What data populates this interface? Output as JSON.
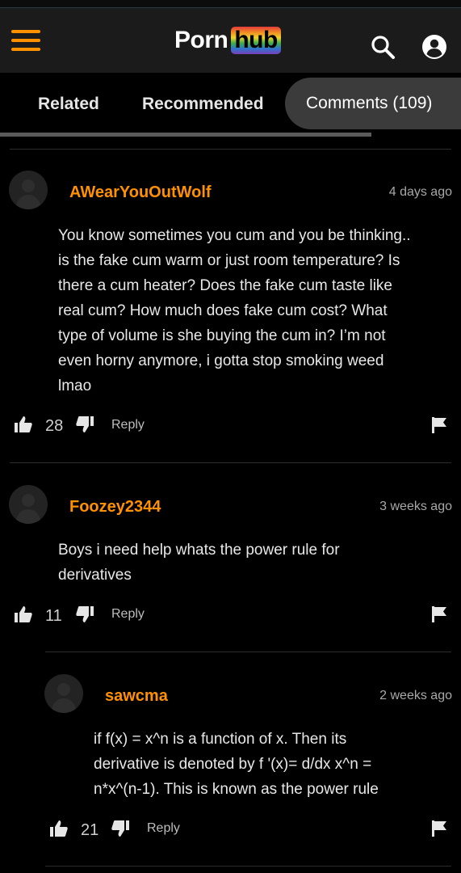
{
  "header": {
    "logo_part1": "Porn",
    "logo_part2": "hub",
    "icons": [
      "menu-icon",
      "search-icon",
      "user-icon"
    ]
  },
  "tabs": [
    {
      "label": "Related"
    },
    {
      "label": "Recommended"
    },
    {
      "label": "Comments (109)",
      "active": true
    }
  ],
  "accent_color": "#ff9000",
  "comments": [
    {
      "username": "AWearYouOutWolf",
      "time": "4 days ago",
      "lines": [
        "You know sometimes you cum and you be thinking..",
        "is the fake cum warm or just room temperature? Is",
        "there a cum heater? Does the fake cum taste like",
        "real cum? How much does fake cum cost? What",
        "type of volume is she buying the cum in? I’m not",
        "even horny anymore, i gotta stop smoking weed",
        "lmao"
      ],
      "likes": "28",
      "reply_label": "Reply"
    },
    {
      "username": "Foozey2344",
      "time": "3 weeks ago",
      "lines": [
        "Boys i need help whats the power rule for",
        "derivatives"
      ],
      "likes": "11",
      "reply_label": "Reply"
    },
    {
      "username": "sawcma",
      "time": "2 weeks ago",
      "lines": [
        "if f(x) = x^n is a function of x. Then its",
        "derivative is denoted by f '(x)= d/dx x^n =",
        "n*x^(n-1). This is known as the power rule"
      ],
      "likes": "21",
      "reply_label": "Reply",
      "is_reply": true
    }
  ]
}
